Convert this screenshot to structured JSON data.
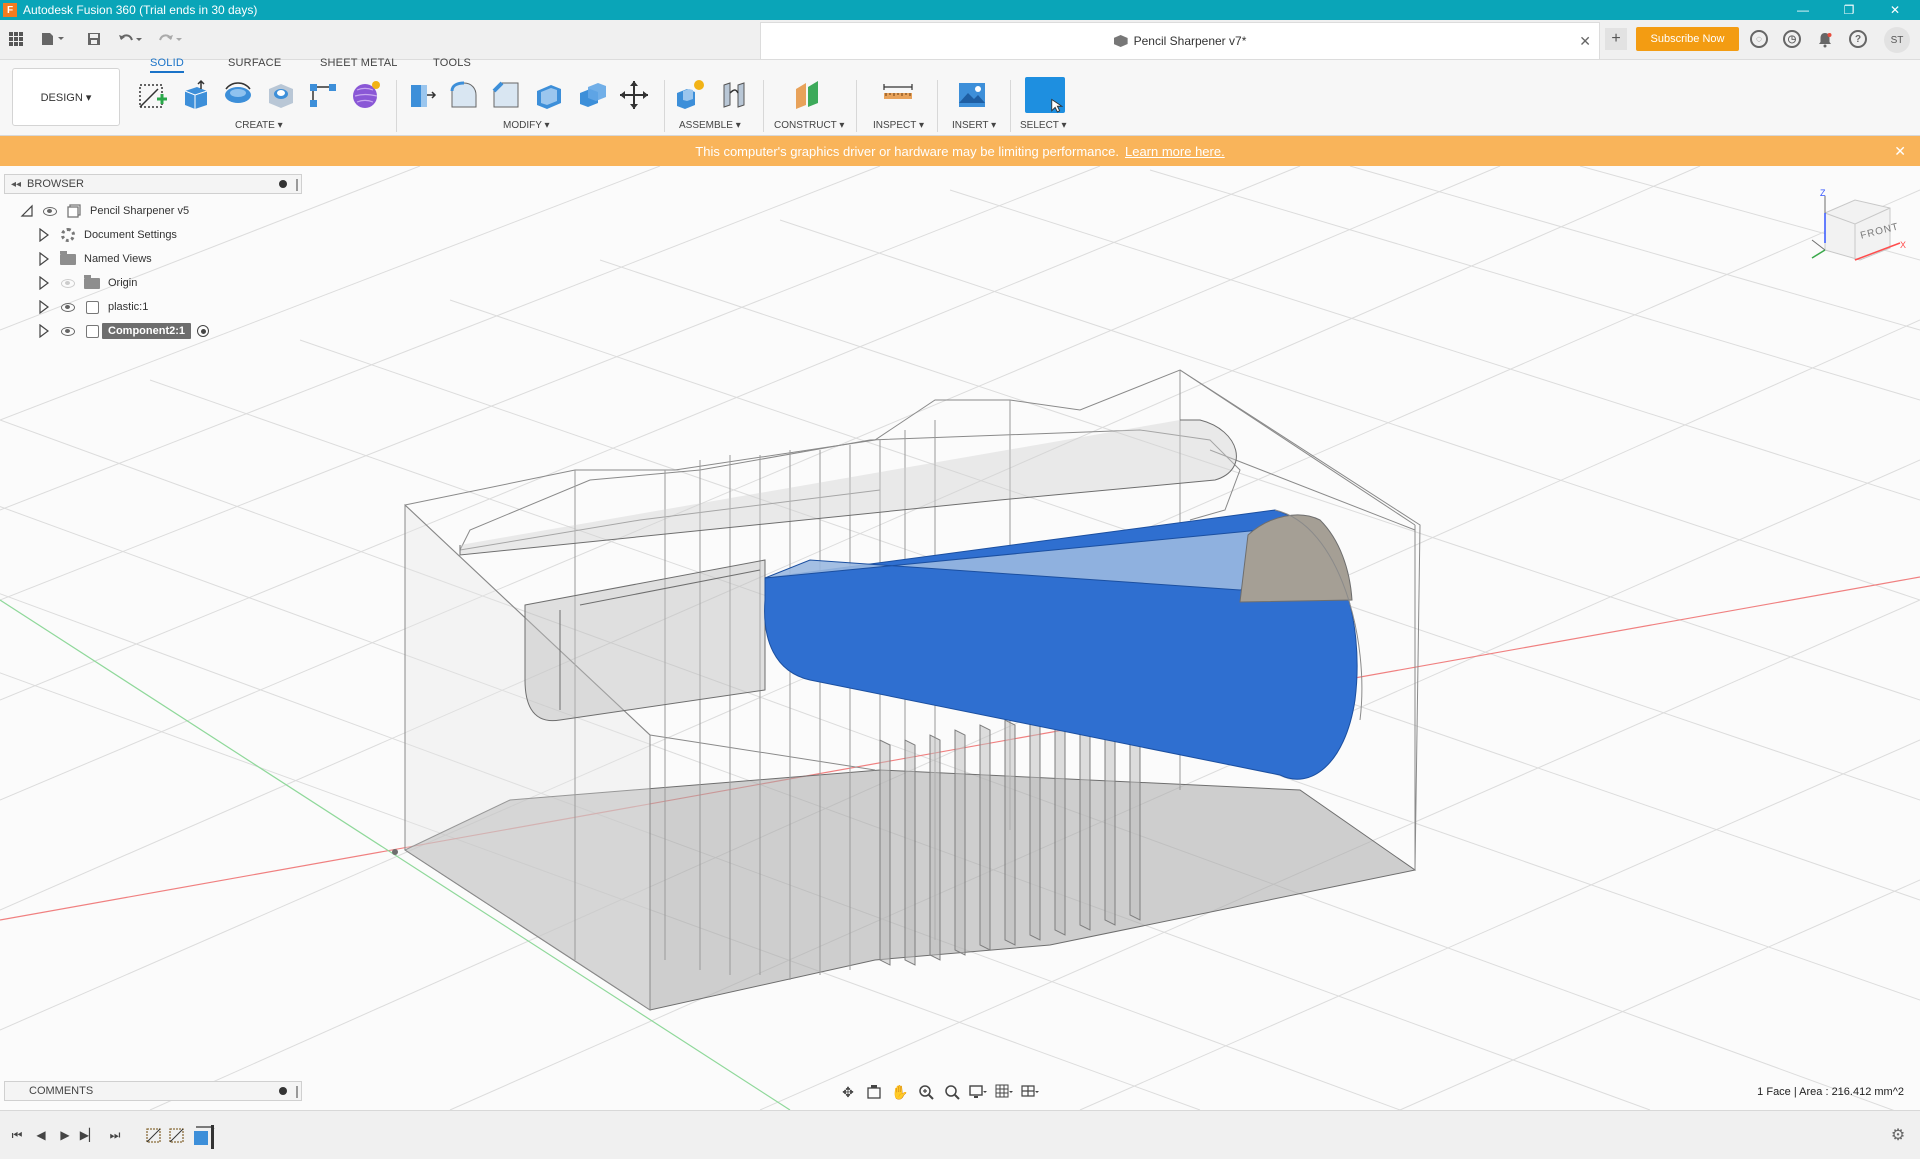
{
  "window": {
    "title": "Autodesk Fusion 360 (Trial ends in 30 days)",
    "controls": {
      "minimize": "—",
      "restore": "❐",
      "close": "✕"
    }
  },
  "document": {
    "tab_title": "Pencil Sharpener v7*",
    "close": "✕",
    "new_tab": "+"
  },
  "header": {
    "subscribe_label": "Subscribe Now",
    "avatar_initials": "ST"
  },
  "ribbon": {
    "workspace": "DESIGN ▾",
    "tabs": [
      "SOLID",
      "SURFACE",
      "SHEET METAL",
      "TOOLS"
    ],
    "groups": {
      "create": "CREATE ▾",
      "modify": "MODIFY ▾",
      "assemble": "ASSEMBLE ▾",
      "construct": "CONSTRUCT ▾",
      "inspect": "INSPECT ▾",
      "insert": "INSERT ▾",
      "select": "SELECT ▾"
    }
  },
  "banner": {
    "message": "This computer's graphics driver or hardware may be limiting performance.",
    "link": "Learn more here.",
    "close": "✕"
  },
  "browser": {
    "title": "BROWSER",
    "items": [
      {
        "label": "Pencil Sharpener v5"
      },
      {
        "label": "Document Settings"
      },
      {
        "label": "Named Views"
      },
      {
        "label": "Origin"
      },
      {
        "label": "plastic:1"
      },
      {
        "label": "Component2:1"
      }
    ]
  },
  "comments": {
    "title": "COMMENTS"
  },
  "viewcube": {
    "face": "FRONT",
    "axis_x": "X",
    "axis_z": "Z"
  },
  "status": {
    "selection": "1 Face | Area : 216.412 mm^2"
  },
  "colors": {
    "titlebar": "#0aa5b8",
    "banner": "#f9b45a",
    "subscribe": "#f39c12",
    "selection_face": "#2f6fd0",
    "active_tab": "#1a73c8"
  }
}
